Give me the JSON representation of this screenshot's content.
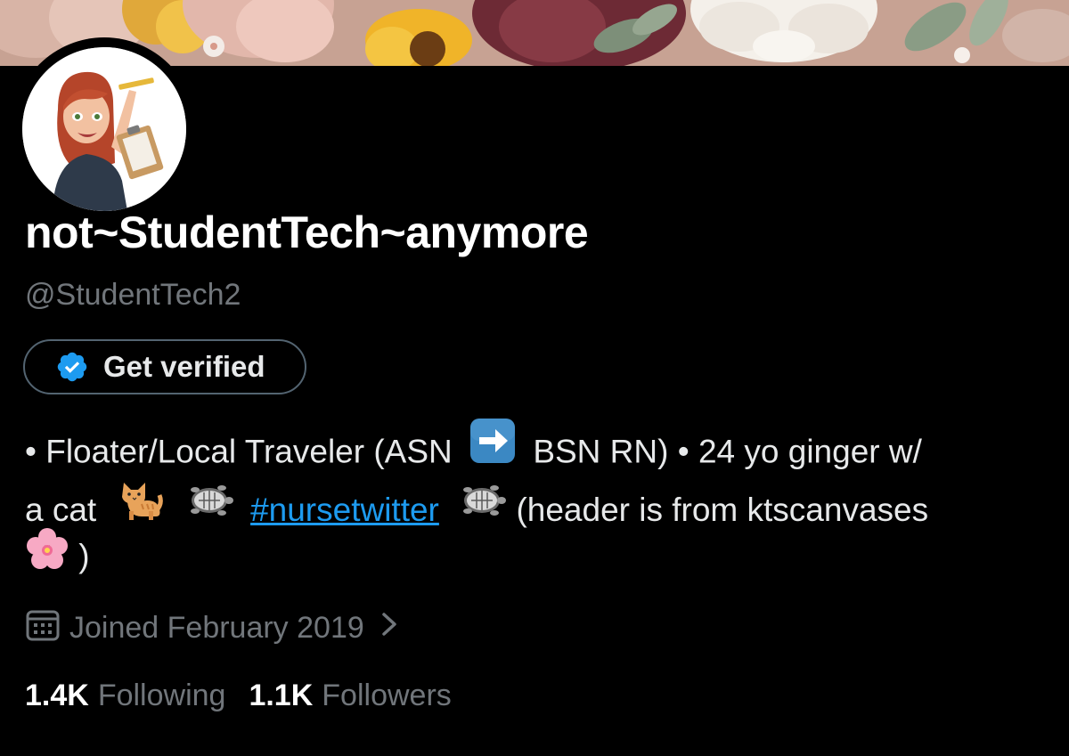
{
  "profile": {
    "display_name": "not~StudentTech~anymore",
    "handle": "@StudentTech2",
    "verify_label": "Get verified",
    "bio": {
      "line1_a": "• Floater/Local Traveler (ASN",
      "line1_emoji": "right-arrow-emoji",
      "line1_b": "BSN RN) • 24 yo ginger w/",
      "line2_a": "a cat",
      "line2_emoji_1": "cat-emoji",
      "line2_emoji_2": "turtle-emoji",
      "hashtag": "#nursetwitter",
      "line2_emoji_3": "turtle-emoji",
      "line2_b": "(header is from ktscanvases",
      "line3_emoji": "cherry-blossom-emoji",
      "line3_b": ")"
    },
    "joined": "Joined February 2019",
    "stats": {
      "following_count": "1.4K",
      "following_label": "Following",
      "followers_count": "1.1K",
      "followers_label": "Followers"
    }
  },
  "colors": {
    "background": "#000000",
    "primary_text": "#e7e9ea",
    "secondary_text": "#71767b",
    "link": "#1d9bf0",
    "verified_badge": "#1d9bf0",
    "button_border": "#536471"
  },
  "icons": {
    "verify_badge": "verified-badge-icon",
    "calendar": "calendar-icon",
    "chevron": "chevron-right-icon"
  }
}
